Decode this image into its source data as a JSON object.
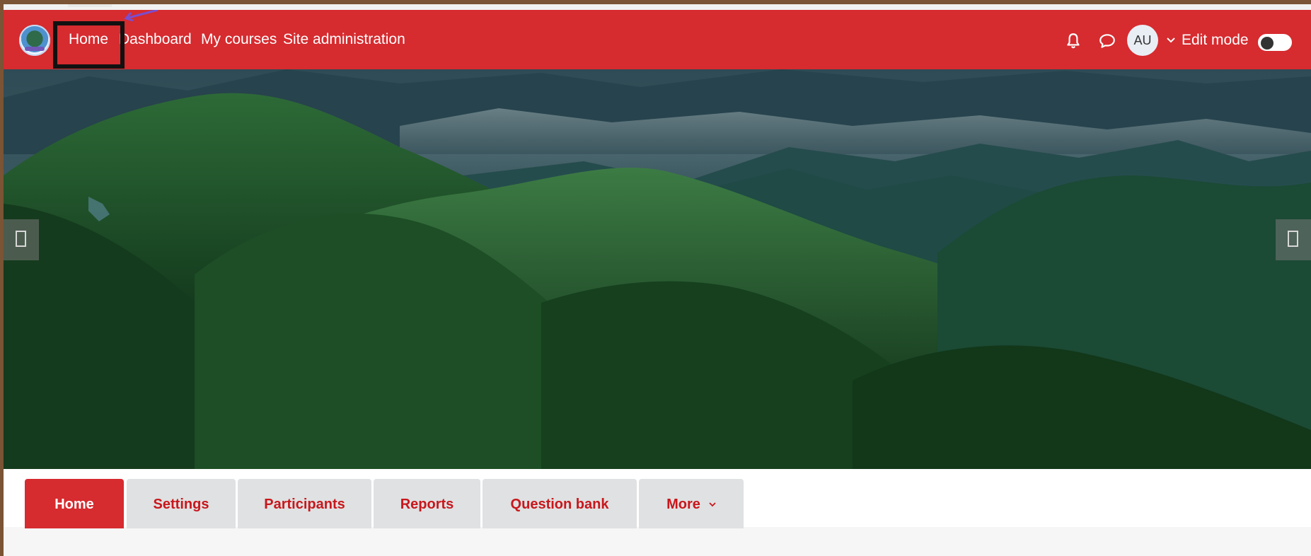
{
  "navbar": {
    "links": [
      "Home",
      "Dashboard",
      "My courses",
      "Site administration"
    ],
    "avatar_initials": "AU",
    "edit_mode_label": "Edit mode",
    "edit_mode_enabled": false,
    "brand_color": "#d62b2f"
  },
  "icons": {
    "notifications": "bell-icon",
    "messages": "chat-icon",
    "user_menu": "chevron-down-icon"
  },
  "hero": {
    "description": "mountain landscape banner"
  },
  "tabs": [
    {
      "label": "Home",
      "active": true
    },
    {
      "label": "Settings",
      "active": false
    },
    {
      "label": "Participants",
      "active": false
    },
    {
      "label": "Reports",
      "active": false
    },
    {
      "label": "Question bank",
      "active": false
    },
    {
      "label": "More",
      "active": false
    }
  ]
}
